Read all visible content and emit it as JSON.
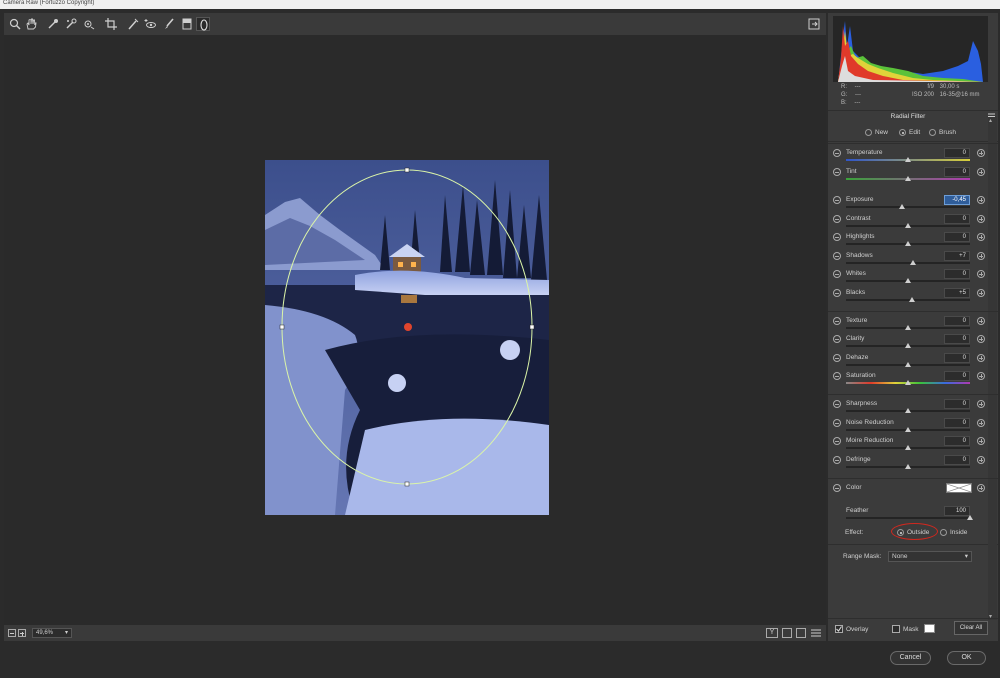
{
  "window": {
    "title": "Camera Raw (Fortuzzo Copyright)"
  },
  "toolbar": {
    "tools": [
      "zoom-tool",
      "hand-tool",
      "white-balance-tool",
      "color-sampler-tool",
      "targeted-adjustment-tool",
      "crop-tool",
      "straighten-tool",
      "spot-removal-tool",
      "red-eye-tool",
      "adjustment-brush-tool",
      "graduated-filter-tool",
      "radial-filter-tool"
    ]
  },
  "image": {
    "description_icon": "photo"
  },
  "status": {
    "zoom": "49,6%"
  },
  "histogram": {
    "rgb": {
      "r_label": "R:",
      "g_label": "G:",
      "b_label": "B:",
      "r": "---",
      "g": "---",
      "b": "---"
    },
    "exif": {
      "aperture": "f/9",
      "shutter": "30,00 s",
      "iso": "ISO 200",
      "lens": "16-35@16 mm"
    }
  },
  "panel": {
    "title": "Radial Filter",
    "modes": {
      "new": "New",
      "edit": "Edit",
      "brush": "Brush",
      "selected": "edit"
    },
    "sliders": [
      {
        "label": "Temperature",
        "value": "0",
        "pos": 0.5
      },
      {
        "label": "Tint",
        "value": "0",
        "pos": 0.5
      },
      {
        "label": "Exposure",
        "value": "-0,45",
        "pos": 0.45
      },
      {
        "label": "Contrast",
        "value": "0",
        "pos": 0.5
      },
      {
        "label": "Highlights",
        "value": "0",
        "pos": 0.5
      },
      {
        "label": "Shadows",
        "value": "+7",
        "pos": 0.54
      },
      {
        "label": "Whites",
        "value": "0",
        "pos": 0.5
      },
      {
        "label": "Blacks",
        "value": "+5",
        "pos": 0.53
      },
      {
        "label": "Texture",
        "value": "0",
        "pos": 0.5
      },
      {
        "label": "Clarity",
        "value": "0",
        "pos": 0.5
      },
      {
        "label": "Dehaze",
        "value": "0",
        "pos": 0.5
      },
      {
        "label": "Saturation",
        "value": "0",
        "pos": 0.5
      },
      {
        "label": "Sharpness",
        "value": "0",
        "pos": 0.5
      },
      {
        "label": "Noise Reduction",
        "value": "0",
        "pos": 0.5
      },
      {
        "label": "Moire Reduction",
        "value": "0",
        "pos": 0.5
      },
      {
        "label": "Defringe",
        "value": "0",
        "pos": 0.5
      }
    ],
    "color": {
      "label": "Color"
    },
    "feather": {
      "label": "Feather",
      "value": "100",
      "pos": 1.0
    },
    "effect": {
      "label": "Effect:",
      "outside": "Outside",
      "inside": "Inside",
      "selected": "outside"
    },
    "range_mask": {
      "label": "Range Mask:",
      "value": "None"
    },
    "overlay": {
      "label": "Overlay",
      "checked": true
    },
    "mask": {
      "label": "Mask",
      "checked": false
    },
    "clear_all": "Clear All"
  },
  "footer": {
    "cancel": "Cancel",
    "ok": "OK"
  }
}
